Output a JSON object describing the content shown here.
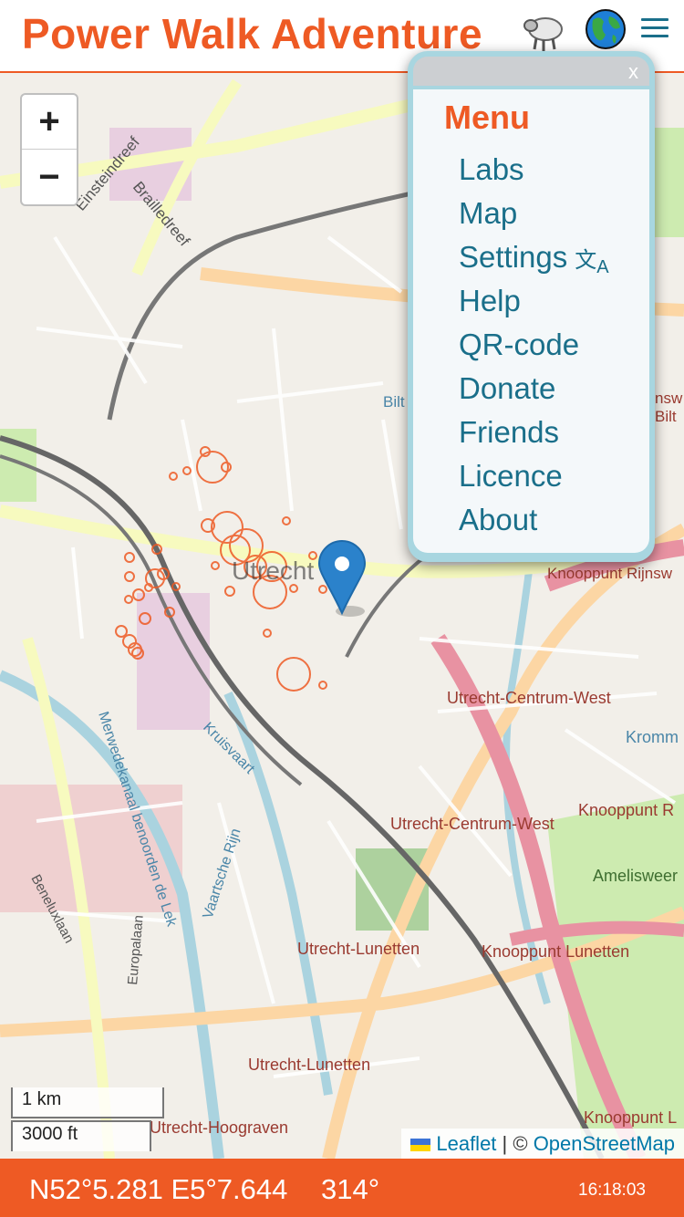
{
  "header": {
    "title": "Power Walk Adventure",
    "icons": [
      "sheep-icon",
      "globe-icon",
      "hamburger-menu-icon"
    ]
  },
  "map": {
    "zoom_in_label": "+",
    "zoom_out_label": "−",
    "scale_metric": "1 km",
    "scale_imperial": "3000 ft",
    "attribution": {
      "leaflet": "Leaflet",
      "separator": " | © ",
      "osm": "OpenStreetMap"
    },
    "labels": {
      "city": "Utrecht",
      "einsteindreef": "Einsteindreef",
      "brailledreef": "Brailledreef",
      "centrum_west_1": "Utrecht-Centrum-West",
      "centrum_west_2": "Utrecht-Centrum-West",
      "lunetten_1": "Utrecht-Lunetten",
      "lunetten_2": "Utrecht-Lunetten",
      "hoograven": "Utrecht-Hoograven",
      "knooppunt_rijnsweerd": "Knooppunt Rijnsw",
      "knooppunt_r": "Knooppunt R",
      "knooppunt_lunetten": "Knooppunt Lunetten",
      "knooppunt_l": "Knooppunt L",
      "amelisweerd": "Amelisweer",
      "kromme": "Kromm",
      "kruisvaart": "Kruisvaart",
      "vaartsche_rijn": "Vaartsche Rijn",
      "merwedekanaal": "Merwedekanaal benoorden de Lek",
      "beneluxlaan": "Beneluxlaan",
      "europalaan": "Europalaan",
      "bilt": "Bilt",
      "bilt2": "Bilt",
      "rijnsw": "nsw"
    }
  },
  "menu": {
    "close_label": "x",
    "heading": "Menu",
    "items": [
      "Labs",
      "Map",
      "Settings",
      "Help",
      "QR-code",
      "Donate",
      "Friends",
      "Licence",
      "About"
    ],
    "settings_icon": "translate-icon"
  },
  "footer": {
    "coordinates": "N52°5.281 E5°7.644",
    "bearing": "314°",
    "time": "16:18:03"
  },
  "colors": {
    "brand": "#ee5a24",
    "menu_link": "#1a6f8a",
    "menu_frame": "#a8d6e0",
    "marker": "#2b82cb"
  }
}
